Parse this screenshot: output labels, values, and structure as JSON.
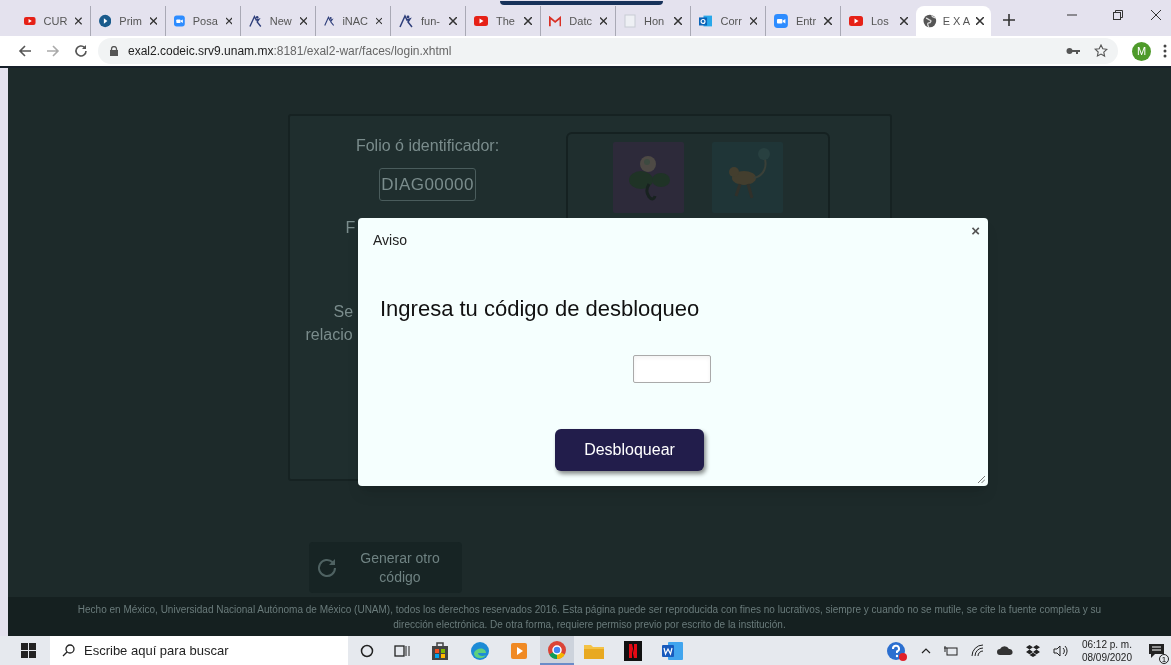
{
  "browser": {
    "tabs": [
      {
        "label": "CUR",
        "kind": "youtube",
        "selected": false
      },
      {
        "label": "Prim",
        "kind": "play",
        "selected": false
      },
      {
        "label": "Posa",
        "kind": "camera",
        "selected": false
      },
      {
        "label": "New",
        "kind": "figure",
        "selected": false
      },
      {
        "label": "iNAC",
        "kind": "figure",
        "selected": false
      },
      {
        "label": "fun-",
        "kind": "figure",
        "selected": false
      },
      {
        "label": "The",
        "kind": "youtube",
        "selected": false
      },
      {
        "label": "Datc",
        "kind": "mail",
        "selected": false
      },
      {
        "label": "Hon",
        "kind": "doc",
        "selected": false
      },
      {
        "label": "Corr",
        "kind": "outlook",
        "selected": false
      },
      {
        "label": "Entr",
        "kind": "camera",
        "selected": false
      },
      {
        "label": "Los",
        "kind": "youtube",
        "selected": false
      },
      {
        "label": "E X A",
        "kind": "globe",
        "selected": true
      }
    ],
    "url_host": "exal2.codeic.srv9.unam.mx",
    "url_path": ":8181/exal2-war/faces/login.xhtml",
    "profile_initial": "M"
  },
  "page": {
    "folio_label": "Folio ó identificador:",
    "folio_value": "DIAG00000",
    "partial_texts": [
      "F",
      "Se",
      "relacio"
    ],
    "regenerate_button": "Generar otro código",
    "footer": "Hecho en México, Universidad Nacional Autónoma de México (UNAM), todos los derechos reservados 2016. Esta página puede ser reproducida con fines no lucrativos, siempre y cuando no se mutile, se cite la fuente completa y su dirección electrónica. De otra forma, requiere permiso previo por escrito de la institución."
  },
  "dialog": {
    "title": "Aviso",
    "close": "×",
    "heading": "Ingresa tu código de desbloqueo",
    "button": "Desbloquear"
  },
  "taskbar": {
    "search_placeholder": "Escribe aquí para buscar",
    "time": "06:12 p. m.",
    "date": "08/09/2020",
    "notification_count": "1"
  }
}
